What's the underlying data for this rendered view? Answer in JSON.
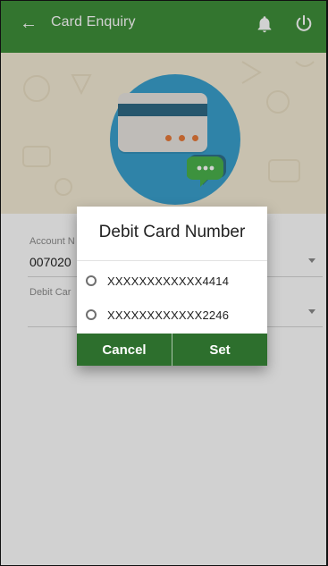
{
  "header": {
    "title": "Card Enquiry",
    "back_icon": "arrow-left-icon",
    "notify_icon": "bell-icon",
    "power_icon": "power-icon"
  },
  "form": {
    "account_label": "Account N",
    "account_value": "007020",
    "debit_card_label": "Debit Car"
  },
  "dialog": {
    "title": "Debit Card Number",
    "options": [
      {
        "label": "XXXXXXXXXXXX4414",
        "selected": false
      },
      {
        "label": "XXXXXXXXXXXX2246",
        "selected": false
      }
    ],
    "cancel_label": "Cancel",
    "set_label": "Set"
  },
  "colors": {
    "primary": "#3f8f3a",
    "dialog_actions": "#2d6f2d",
    "banner_bg": "#f5ecd6",
    "banner_circle": "#3aa0cd"
  }
}
